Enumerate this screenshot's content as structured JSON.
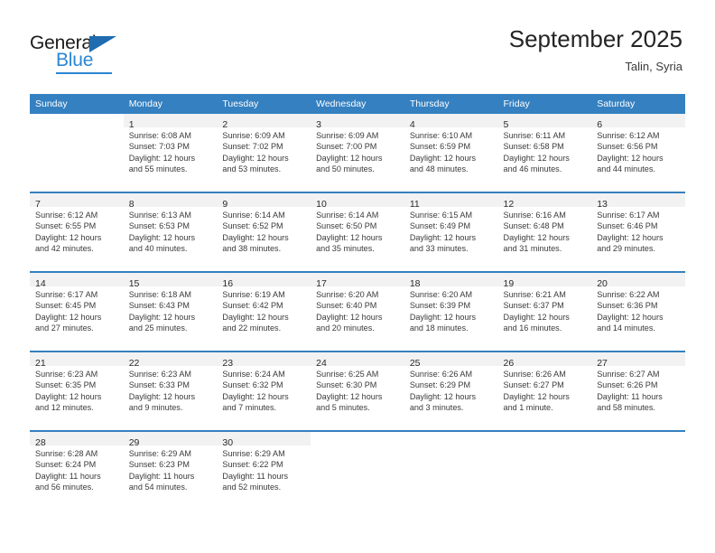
{
  "brand": {
    "name_dark": "General",
    "name_blue": "Blue",
    "logo_icon": "triangle-icon",
    "accent_color": "#2a86d4",
    "header_color": "#3580c0"
  },
  "header": {
    "month_title": "September 2025",
    "location": "Talin, Syria"
  },
  "calendar": {
    "columns": [
      "Sunday",
      "Monday",
      "Tuesday",
      "Wednesday",
      "Thursday",
      "Friday",
      "Saturday"
    ],
    "weeks": [
      {
        "days": [
          {
            "day": ""
          },
          {
            "day": "1",
            "sunrise": "Sunrise: 6:08 AM",
            "sunset": "Sunset: 7:03 PM",
            "daylight_1": "Daylight: 12 hours",
            "daylight_2": "and 55 minutes."
          },
          {
            "day": "2",
            "sunrise": "Sunrise: 6:09 AM",
            "sunset": "Sunset: 7:02 PM",
            "daylight_1": "Daylight: 12 hours",
            "daylight_2": "and 53 minutes."
          },
          {
            "day": "3",
            "sunrise": "Sunrise: 6:09 AM",
            "sunset": "Sunset: 7:00 PM",
            "daylight_1": "Daylight: 12 hours",
            "daylight_2": "and 50 minutes."
          },
          {
            "day": "4",
            "sunrise": "Sunrise: 6:10 AM",
            "sunset": "Sunset: 6:59 PM",
            "daylight_1": "Daylight: 12 hours",
            "daylight_2": "and 48 minutes."
          },
          {
            "day": "5",
            "sunrise": "Sunrise: 6:11 AM",
            "sunset": "Sunset: 6:58 PM",
            "daylight_1": "Daylight: 12 hours",
            "daylight_2": "and 46 minutes."
          },
          {
            "day": "6",
            "sunrise": "Sunrise: 6:12 AM",
            "sunset": "Sunset: 6:56 PM",
            "daylight_1": "Daylight: 12 hours",
            "daylight_2": "and 44 minutes."
          }
        ]
      },
      {
        "days": [
          {
            "day": "7",
            "sunrise": "Sunrise: 6:12 AM",
            "sunset": "Sunset: 6:55 PM",
            "daylight_1": "Daylight: 12 hours",
            "daylight_2": "and 42 minutes."
          },
          {
            "day": "8",
            "sunrise": "Sunrise: 6:13 AM",
            "sunset": "Sunset: 6:53 PM",
            "daylight_1": "Daylight: 12 hours",
            "daylight_2": "and 40 minutes."
          },
          {
            "day": "9",
            "sunrise": "Sunrise: 6:14 AM",
            "sunset": "Sunset: 6:52 PM",
            "daylight_1": "Daylight: 12 hours",
            "daylight_2": "and 38 minutes."
          },
          {
            "day": "10",
            "sunrise": "Sunrise: 6:14 AM",
            "sunset": "Sunset: 6:50 PM",
            "daylight_1": "Daylight: 12 hours",
            "daylight_2": "and 35 minutes."
          },
          {
            "day": "11",
            "sunrise": "Sunrise: 6:15 AM",
            "sunset": "Sunset: 6:49 PM",
            "daylight_1": "Daylight: 12 hours",
            "daylight_2": "and 33 minutes."
          },
          {
            "day": "12",
            "sunrise": "Sunrise: 6:16 AM",
            "sunset": "Sunset: 6:48 PM",
            "daylight_1": "Daylight: 12 hours",
            "daylight_2": "and 31 minutes."
          },
          {
            "day": "13",
            "sunrise": "Sunrise: 6:17 AM",
            "sunset": "Sunset: 6:46 PM",
            "daylight_1": "Daylight: 12 hours",
            "daylight_2": "and 29 minutes."
          }
        ]
      },
      {
        "days": [
          {
            "day": "14",
            "sunrise": "Sunrise: 6:17 AM",
            "sunset": "Sunset: 6:45 PM",
            "daylight_1": "Daylight: 12 hours",
            "daylight_2": "and 27 minutes."
          },
          {
            "day": "15",
            "sunrise": "Sunrise: 6:18 AM",
            "sunset": "Sunset: 6:43 PM",
            "daylight_1": "Daylight: 12 hours",
            "daylight_2": "and 25 minutes."
          },
          {
            "day": "16",
            "sunrise": "Sunrise: 6:19 AM",
            "sunset": "Sunset: 6:42 PM",
            "daylight_1": "Daylight: 12 hours",
            "daylight_2": "and 22 minutes."
          },
          {
            "day": "17",
            "sunrise": "Sunrise: 6:20 AM",
            "sunset": "Sunset: 6:40 PM",
            "daylight_1": "Daylight: 12 hours",
            "daylight_2": "and 20 minutes."
          },
          {
            "day": "18",
            "sunrise": "Sunrise: 6:20 AM",
            "sunset": "Sunset: 6:39 PM",
            "daylight_1": "Daylight: 12 hours",
            "daylight_2": "and 18 minutes."
          },
          {
            "day": "19",
            "sunrise": "Sunrise: 6:21 AM",
            "sunset": "Sunset: 6:37 PM",
            "daylight_1": "Daylight: 12 hours",
            "daylight_2": "and 16 minutes."
          },
          {
            "day": "20",
            "sunrise": "Sunrise: 6:22 AM",
            "sunset": "Sunset: 6:36 PM",
            "daylight_1": "Daylight: 12 hours",
            "daylight_2": "and 14 minutes."
          }
        ]
      },
      {
        "days": [
          {
            "day": "21",
            "sunrise": "Sunrise: 6:23 AM",
            "sunset": "Sunset: 6:35 PM",
            "daylight_1": "Daylight: 12 hours",
            "daylight_2": "and 12 minutes."
          },
          {
            "day": "22",
            "sunrise": "Sunrise: 6:23 AM",
            "sunset": "Sunset: 6:33 PM",
            "daylight_1": "Daylight: 12 hours",
            "daylight_2": "and 9 minutes."
          },
          {
            "day": "23",
            "sunrise": "Sunrise: 6:24 AM",
            "sunset": "Sunset: 6:32 PM",
            "daylight_1": "Daylight: 12 hours",
            "daylight_2": "and 7 minutes."
          },
          {
            "day": "24",
            "sunrise": "Sunrise: 6:25 AM",
            "sunset": "Sunset: 6:30 PM",
            "daylight_1": "Daylight: 12 hours",
            "daylight_2": "and 5 minutes."
          },
          {
            "day": "25",
            "sunrise": "Sunrise: 6:26 AM",
            "sunset": "Sunset: 6:29 PM",
            "daylight_1": "Daylight: 12 hours",
            "daylight_2": "and 3 minutes."
          },
          {
            "day": "26",
            "sunrise": "Sunrise: 6:26 AM",
            "sunset": "Sunset: 6:27 PM",
            "daylight_1": "Daylight: 12 hours",
            "daylight_2": "and 1 minute."
          },
          {
            "day": "27",
            "sunrise": "Sunrise: 6:27 AM",
            "sunset": "Sunset: 6:26 PM",
            "daylight_1": "Daylight: 11 hours",
            "daylight_2": "and 58 minutes."
          }
        ]
      },
      {
        "days": [
          {
            "day": "28",
            "sunrise": "Sunrise: 6:28 AM",
            "sunset": "Sunset: 6:24 PM",
            "daylight_1": "Daylight: 11 hours",
            "daylight_2": "and 56 minutes."
          },
          {
            "day": "29",
            "sunrise": "Sunrise: 6:29 AM",
            "sunset": "Sunset: 6:23 PM",
            "daylight_1": "Daylight: 11 hours",
            "daylight_2": "and 54 minutes."
          },
          {
            "day": "30",
            "sunrise": "Sunrise: 6:29 AM",
            "sunset": "Sunset: 6:22 PM",
            "daylight_1": "Daylight: 11 hours",
            "daylight_2": "and 52 minutes."
          },
          {
            "day": ""
          },
          {
            "day": ""
          },
          {
            "day": ""
          },
          {
            "day": ""
          }
        ]
      }
    ]
  }
}
